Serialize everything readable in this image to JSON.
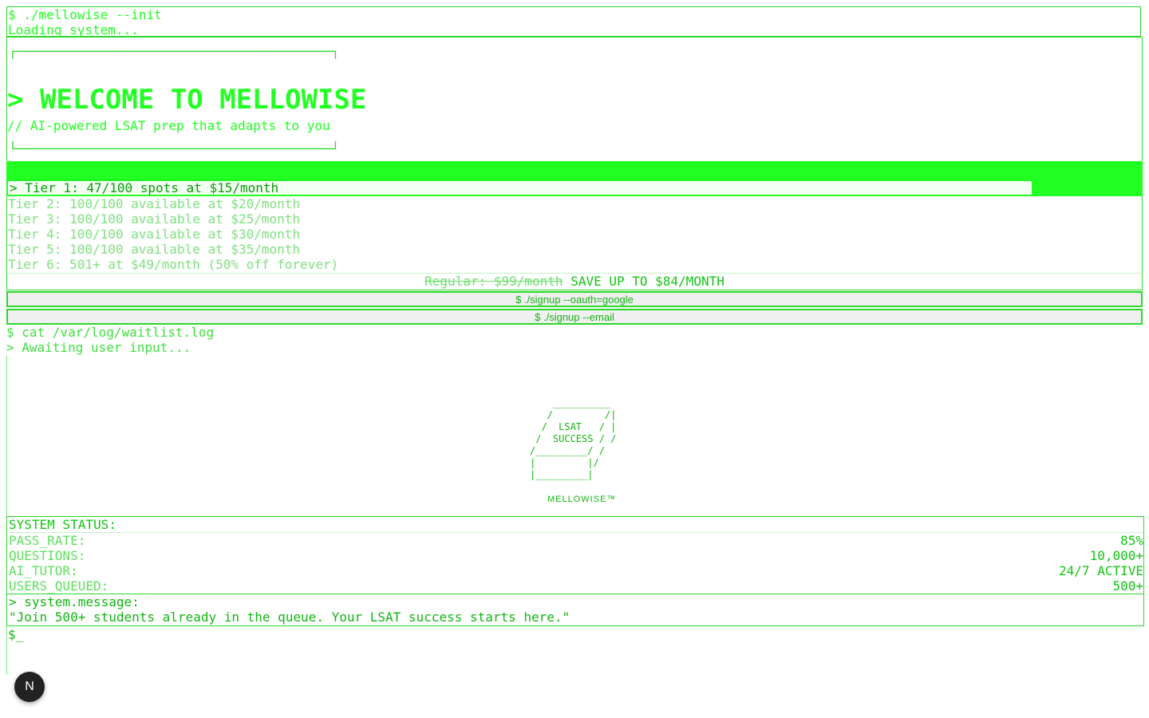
{
  "boot": {
    "command": "$ ./mellowise --init",
    "status": "Loading system..."
  },
  "hero": {
    "corner_top": "┌─────────────────────────────────────────┐",
    "corner_bottom": "└─────────────────────────────────────────┘",
    "title": "> WELCOME TO MELLOWISE",
    "subtitle": "// AI-powered LSAT prep that adapts to you"
  },
  "tiers": {
    "active": "> Tier 1: 47/100 spots at $15/month",
    "items": [
      "Tier 2: 100/100 available at $20/month",
      "Tier 3: 100/100 available at $25/month",
      "Tier 4: 100/100 available at $30/month",
      "Tier 5: 100/100 available at $35/month",
      "Tier 6: 501+ at $49/month (50% off forever)"
    ]
  },
  "pricing": {
    "regular": "Regular: $99/month",
    "save": "SAVE UP TO $84/MONTH"
  },
  "signup": {
    "google": "$ ./signup --oauth=google",
    "email": "$ ./signup --email"
  },
  "log": {
    "command": "$ cat /var/log/waitlist.log",
    "status": "> Awaiting user input..."
  },
  "art": {
    "ascii": "    __________\n   /         /|\n  /  LSAT   / |\n /  SUCCESS / /\n/_________/ /\n|         |/\n|_________|",
    "brand": "MELLOWISE™"
  },
  "status": {
    "title": "SYSTEM STATUS:",
    "rows": [
      {
        "key": "PASS_RATE:",
        "value": "85%"
      },
      {
        "key": "QUESTIONS:",
        "value": "10,000+"
      },
      {
        "key": "AI_TUTOR:",
        "value": "24/7 ACTIVE"
      },
      {
        "key": "USERS_QUEUED:",
        "value": "500+"
      }
    ]
  },
  "message": {
    "label": "> system.message:",
    "text": "\"Join 500+ students already in the queue. Your LSAT success starts here.\""
  },
  "prompt": "$_",
  "badge": "N"
}
